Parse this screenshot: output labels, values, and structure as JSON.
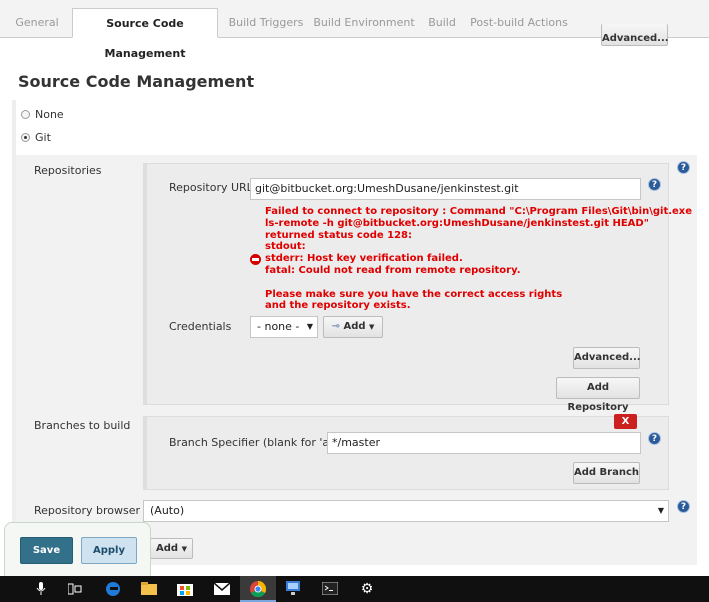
{
  "tabs": [
    {
      "label": "General"
    },
    {
      "label": "Source Code Management"
    },
    {
      "label": "Build Triggers"
    },
    {
      "label": "Build Environment"
    },
    {
      "label": "Build"
    },
    {
      "label": "Post-build Actions"
    }
  ],
  "top_advanced_label": "Advanced...",
  "section_title": "Source Code Management",
  "scm_options": [
    {
      "label": "None",
      "checked": false
    },
    {
      "label": "Git",
      "checked": true
    }
  ],
  "repositories": {
    "label": "Repositories",
    "url_label": "Repository URL",
    "url_value": "git@bitbucket.org:UmeshDusane/jenkinstest.git",
    "error_lines": [
      "Failed to connect to repository : Command \"C:\\Program Files\\Git\\bin\\git.exe",
      "ls-remote -h git@bitbucket.org:UmeshDusane/jenkinstest.git HEAD\"",
      "returned status code 128:",
      "stdout:",
      "stderr: Host key verification failed.",
      "fatal: Could not read from remote repository.",
      "",
      "Please make sure you have the correct access rights",
      "and the repository exists."
    ],
    "credentials_label": "Credentials",
    "credentials_value": "- none -",
    "add_label": "Add",
    "advanced_label": "Advanced...",
    "add_repository_label": "Add Repository"
  },
  "branches": {
    "label": "Branches to build",
    "delete_label": "X",
    "specifier_label": "Branch Specifier (blank for 'any')",
    "specifier_value": "*/master",
    "add_branch_label": "Add Branch"
  },
  "repo_browser": {
    "label": "Repository browser",
    "value": "(Auto)"
  },
  "additional_add_label": "Add",
  "footer": {
    "save_label": "Save",
    "apply_label": "Apply"
  },
  "help_glyph": "?",
  "taskbar_icons": [
    "microphone-icon",
    "task-view-icon",
    "edge-icon",
    "file-explorer-icon",
    "store-icon",
    "mail-icon",
    "chrome-icon",
    "remote-desktop-icon",
    "terminal-icon",
    "settings-icon"
  ],
  "colors": {
    "error": "#e00000",
    "save_button": "#33708a",
    "apply_button": "#cfe2ef",
    "help_icon": "#2c5b9a",
    "delete_button": "#cc1f1f"
  }
}
